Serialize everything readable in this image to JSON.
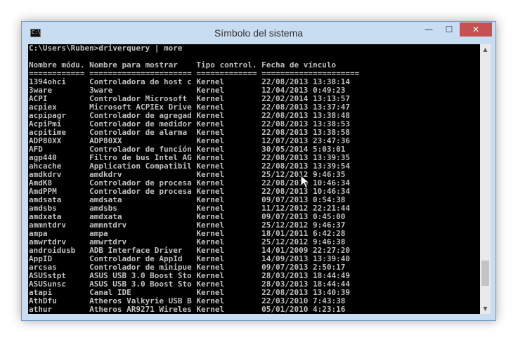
{
  "window": {
    "title": "Símbolo del sistema",
    "icon_text": "C:\\_",
    "controls": {
      "minimize": "—",
      "maximize": "☐",
      "close": "✕"
    }
  },
  "console": {
    "prompt": "C:\\Users\\Ruben>driverquery | more",
    "headers": [
      "Nombre módu.",
      "Nombre para mostrar",
      "Tipo control.",
      "Fecha de vínculo"
    ],
    "rows": [
      [
        "1394ohci",
        "Controladora de host c",
        "Kernel",
        "22/08/2013 13:38:14"
      ],
      [
        "3ware",
        "3ware",
        "Kernel",
        "12/04/2013 0:49:23"
      ],
      [
        "ACPI",
        "Controlador Microsoft",
        "Kernel",
        "22/02/2014 13:13:57"
      ],
      [
        "acpiex",
        "Microsoft ACPIEx Drive",
        "Kernel",
        "22/08/2013 13:37:47"
      ],
      [
        "acpipagr",
        "Controlador de agregad",
        "Kernel",
        "22/08/2013 13:38:48"
      ],
      [
        "AcpiPmi",
        "Controlador de medidor",
        "Kernel",
        "22/08/2013 13:38:53"
      ],
      [
        "acpitime",
        "Controlador de alarma",
        "Kernel",
        "22/08/2013 13:38:58"
      ],
      [
        "ADP80XX",
        "ADP80XX",
        "Kernel",
        "12/07/2013 23:47:36"
      ],
      [
        "AFD",
        "Controlador de función",
        "Kernel",
        "30/05/2014 5:03:01"
      ],
      [
        "agp440",
        "Filtro de bus Intel AG",
        "Kernel",
        "22/08/2013 13:39:35"
      ],
      [
        "ahcache",
        "Application Compatibil",
        "Kernel",
        "22/08/2013 13:39:54"
      ],
      [
        "amdkdrv",
        "amdkdrv",
        "Kernel",
        "25/12/2012 9:46:35"
      ],
      [
        "AmdK8",
        "Controlador de procesa",
        "Kernel",
        "22/08/2013 10:46:34"
      ],
      [
        "AmdPPM",
        "Controlador de procesa",
        "Kernel",
        "22/08/2013 10:46:34"
      ],
      [
        "amdsata",
        "amdsata",
        "Kernel",
        "09/07/2013 0:54:38"
      ],
      [
        "amdsbs",
        "amdsbs",
        "Kernel",
        "11/12/2012 22:21:44"
      ],
      [
        "amdxata",
        "amdxata",
        "Kernel",
        "09/07/2013 0:45:00"
      ],
      [
        "ammntdrv",
        "ammntdrv",
        "Kernel",
        "25/12/2012 9:46:37"
      ],
      [
        "ampa",
        "ampa",
        "Kernel",
        "18/01/2011 6:42:28"
      ],
      [
        "amwrtdrv",
        "amwrtdrv",
        "Kernel",
        "25/12/2012 9:46:38"
      ],
      [
        "androidusb",
        "ADB Interface Driver",
        "Kernel",
        "14/01/2009 22:27:20"
      ],
      [
        "AppID",
        "Controlador de AppId",
        "Kernel",
        "14/09/2013 13:39:40"
      ],
      [
        "arcsas",
        "Controlador de minipue",
        "Kernel",
        "09/07/2013 2:50:17"
      ],
      [
        "ASUSstpt",
        "ASUS USB 3.0 Boost Sto",
        "Kernel",
        "28/03/2013 18:44:49"
      ],
      [
        "ASUSunsc",
        "ASUS USB 3.0 Boost Sto",
        "Kernel",
        "28/03/2013 18:44:44"
      ],
      [
        "atapi",
        "Canal IDE",
        "Kernel",
        "22/08/2013 13:40:39"
      ],
      [
        "AthDfu",
        "Atheros Valkyrie USB B",
        "Kernel",
        "22/03/2010 7:43:38"
      ],
      [
        "athur",
        "Atheros AR9271 Wireles",
        "Kernel",
        "05/01/2010 4:23:16"
      ]
    ]
  },
  "scrollbar": {
    "up": "▲",
    "down": "▼",
    "position": 0.92
  }
}
